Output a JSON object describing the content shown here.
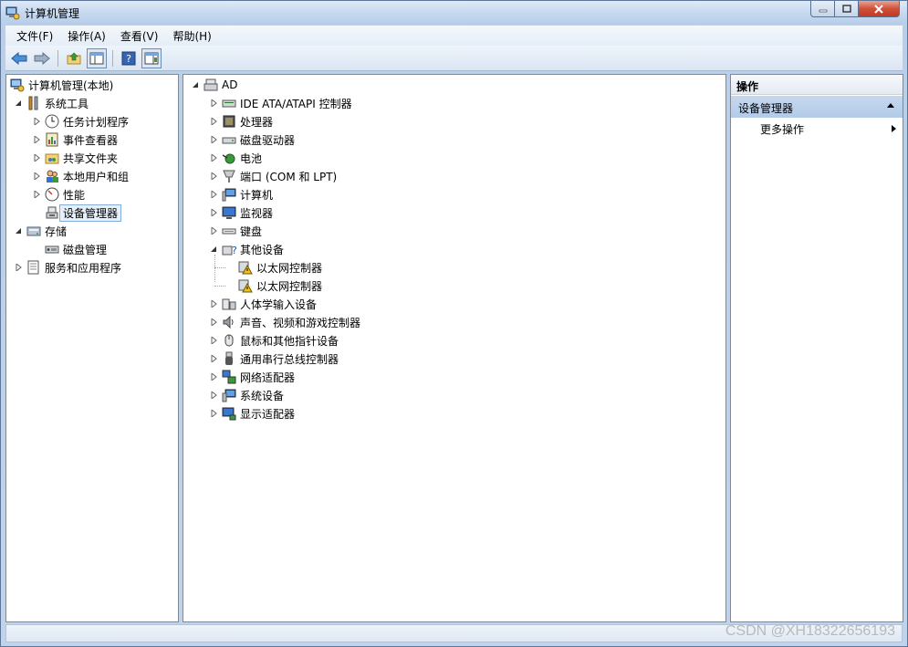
{
  "window": {
    "title": "计算机管理",
    "accent": "#b7cde9"
  },
  "menu": [
    "文件(F)",
    "操作(A)",
    "查看(V)",
    "帮助(H)"
  ],
  "toolbar": {
    "buttons": [
      "back-arrow-icon",
      "forward-arrow-icon",
      "up-folder-icon",
      "show-tree-icon",
      "help-icon",
      "action-pane-icon"
    ]
  },
  "left_tree": {
    "root": "计算机管理(本地)",
    "items": [
      {
        "label": "系统工具"
      },
      {
        "label": "任务计划程序"
      },
      {
        "label": "事件查看器"
      },
      {
        "label": "共享文件夹"
      },
      {
        "label": "本地用户和组"
      },
      {
        "label": "性能"
      },
      {
        "label": "设备管理器"
      },
      {
        "label": "存储"
      },
      {
        "label": "磁盘管理"
      },
      {
        "label": "服务和应用程序"
      }
    ]
  },
  "device_tree": {
    "root": "AD",
    "items": [
      {
        "label": "IDE ATA/ATAPI 控制器"
      },
      {
        "label": "处理器"
      },
      {
        "label": "磁盘驱动器"
      },
      {
        "label": "电池"
      },
      {
        "label": "端口 (COM 和 LPT)"
      },
      {
        "label": "计算机"
      },
      {
        "label": "监视器"
      },
      {
        "label": "键盘"
      },
      {
        "label": "其他设备"
      },
      {
        "label": "以太网控制器"
      },
      {
        "label": "以太网控制器"
      },
      {
        "label": "人体学输入设备"
      },
      {
        "label": "声音、视频和游戏控制器"
      },
      {
        "label": "鼠标和其他指针设备"
      },
      {
        "label": "通用串行总线控制器"
      },
      {
        "label": "网络适配器"
      },
      {
        "label": "系统设备"
      },
      {
        "label": "显示适配器"
      }
    ]
  },
  "actions": {
    "header": "操作",
    "section": "设备管理器",
    "more": "更多操作"
  },
  "watermark": "CSDN @XH18322656193"
}
